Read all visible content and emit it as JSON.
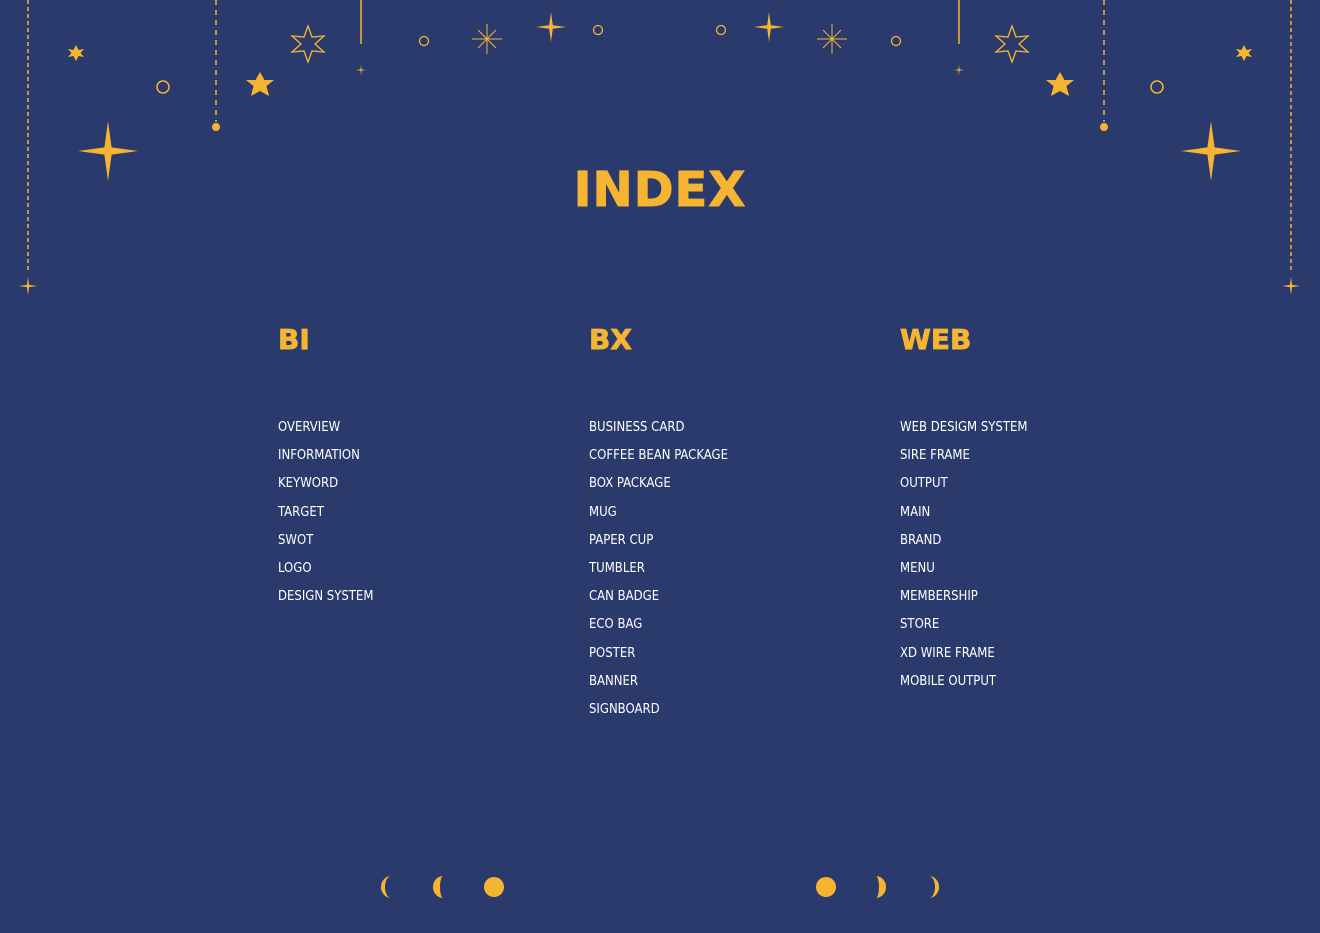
{
  "page": {
    "title": "INDEX",
    "colors": {
      "background": "#2b3a6c",
      "accent": "#f5b531",
      "text": "#ffffff"
    }
  },
  "columns": [
    {
      "heading": "BI",
      "items": [
        "OVERVIEW",
        "INFORMATION",
        "KEYWORD",
        "TARGET",
        "SWOT",
        "LOGO",
        "DESIGN SYSTEM"
      ]
    },
    {
      "heading": "BX",
      "items": [
        "BUSINESS CARD",
        "COFFEE BEAN PACKAGE",
        "BOX PACKAGE",
        "MUG",
        "PAPER CUP",
        "TUMBLER",
        "CAN BADGE",
        "ECO BAG",
        "POSTER",
        "BANNER",
        "SIGNBOARD"
      ]
    },
    {
      "heading": "WEB",
      "items": [
        "WEB DESIGM SYSTEM",
        "SIRE FRAME",
        "OUTPUT",
        "MAIN",
        "BRAND",
        "MENU",
        "MEMBERSHIP",
        "STORE",
        "XD WIRE FRAME",
        "MOBILE OUTPUT"
      ]
    }
  ],
  "decorations": {
    "icons": [
      "star-icon",
      "sparkle-icon",
      "hanging-ornament-icon",
      "ring-icon",
      "moon-phase-icon"
    ]
  }
}
